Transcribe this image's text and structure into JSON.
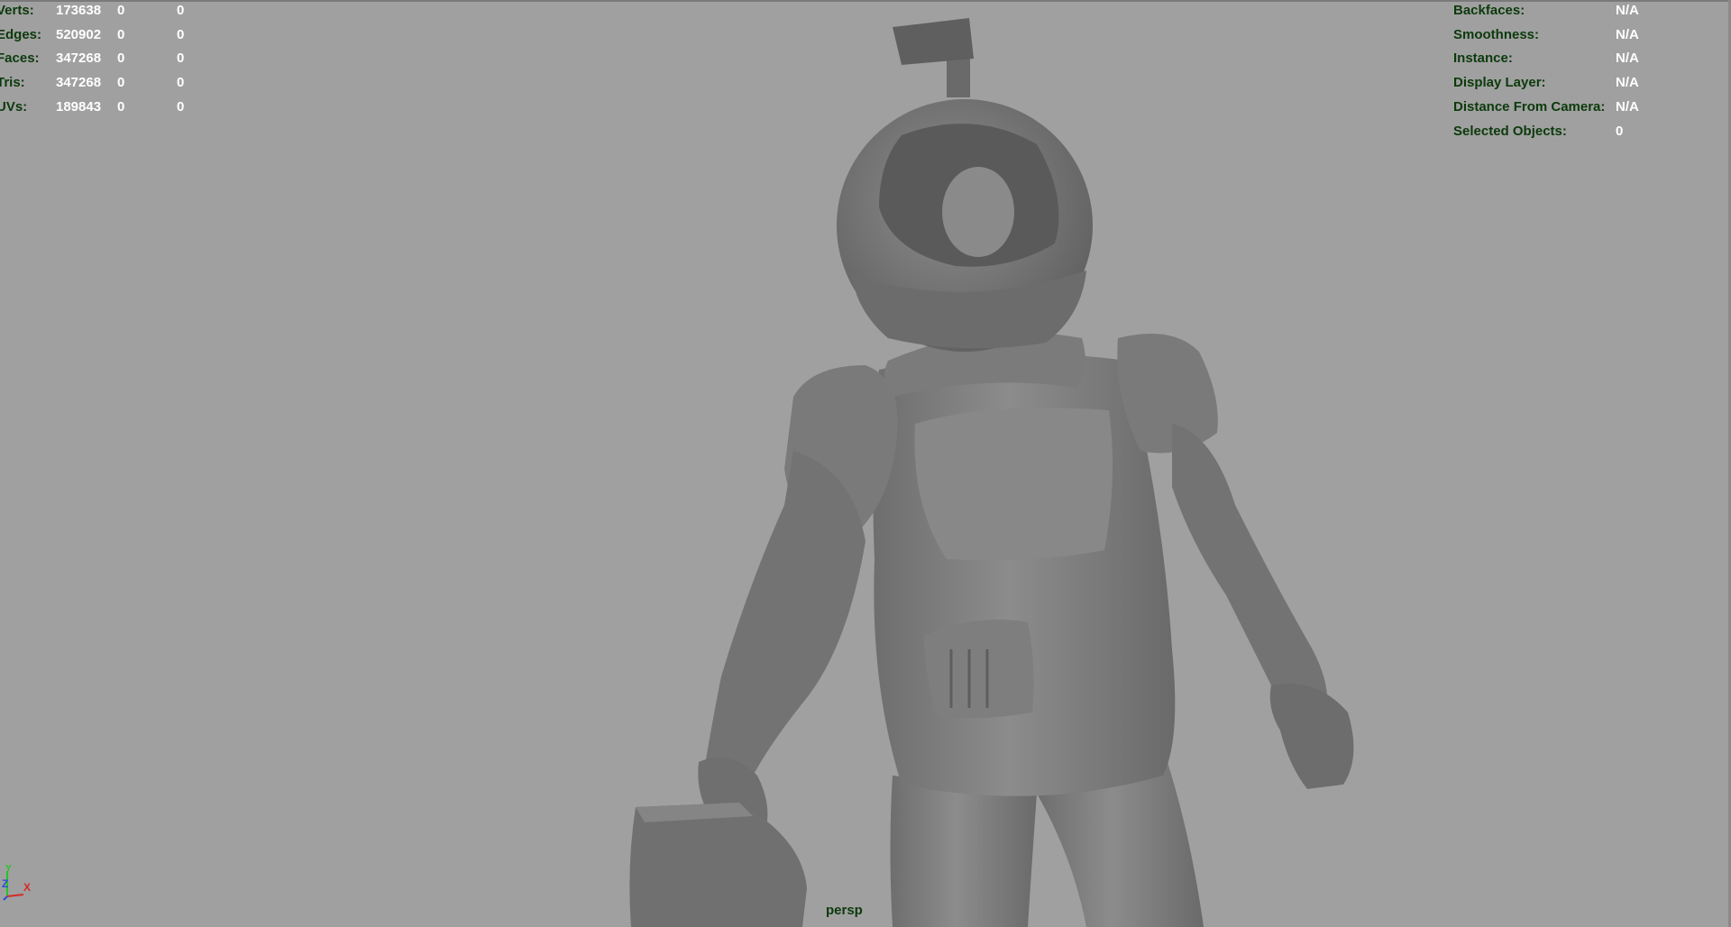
{
  "stats": {
    "rows": [
      {
        "label": "Verts:",
        "values": [
          "173638",
          "0",
          "0"
        ]
      },
      {
        "label": "Edges:",
        "values": [
          "520902",
          "0",
          "0"
        ]
      },
      {
        "label": "Faces:",
        "values": [
          "347268",
          "0",
          "0"
        ]
      },
      {
        "label": "Tris:",
        "values": [
          "347268",
          "0",
          "0"
        ]
      },
      {
        "label": "UVs:",
        "values": [
          "189843",
          "0",
          "0"
        ]
      }
    ]
  },
  "info": {
    "rows": [
      {
        "label": "Backfaces:",
        "value": "N/A"
      },
      {
        "label": "Smoothness:",
        "value": "N/A"
      },
      {
        "label": "Instance:",
        "value": "N/A"
      },
      {
        "label": "Display Layer:",
        "value": "N/A"
      },
      {
        "label": "Distance From Camera:",
        "value": "N/A"
      },
      {
        "label": "Selected Objects:",
        "value": "0"
      }
    ]
  },
  "camera": {
    "name": "persp"
  },
  "axis": {
    "y": "Y",
    "z": "Z",
    "x": "X",
    "colors": {
      "y": "#22c622",
      "z": "#2a4fd8",
      "x": "#d62a2a"
    }
  },
  "colors": {
    "viewport_bg": "#a0a0a0",
    "hud_label": "#0c3a0c",
    "hud_value": "#ffffff",
    "model": "#7c7c7c"
  }
}
